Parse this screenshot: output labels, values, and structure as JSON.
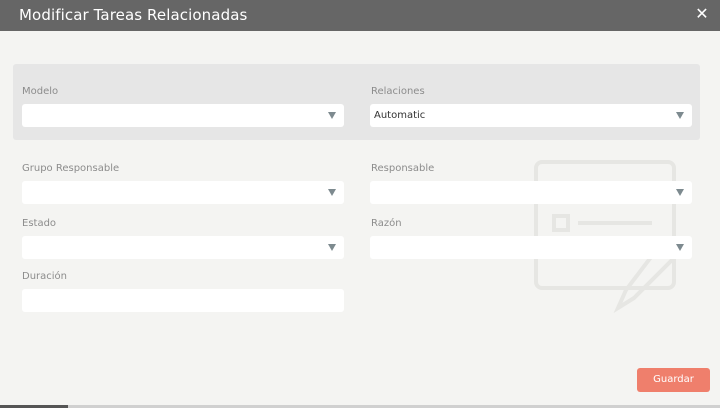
{
  "dialog": {
    "title": "Modificar Tareas Relacionadas",
    "close_icon": "close-icon"
  },
  "fields": {
    "modelo": {
      "label": "Modelo",
      "value": ""
    },
    "relaciones": {
      "label": "Relaciones",
      "value": "Automatic"
    },
    "grupo_responsable": {
      "label": "Grupo Responsable",
      "value": ""
    },
    "responsable": {
      "label": "Responsable",
      "value": ""
    },
    "estado": {
      "label": "Estado",
      "value": ""
    },
    "razon": {
      "label": "Razón",
      "value": ""
    },
    "duracion": {
      "label": "Duración",
      "value": ""
    }
  },
  "actions": {
    "save_label": "Guardar"
  },
  "colors": {
    "titlebar": "#666666",
    "background": "#f4f4f2",
    "panel": "#e6e6e6",
    "label": "#8c8c8c",
    "primary_button": "#ef7f6c"
  }
}
